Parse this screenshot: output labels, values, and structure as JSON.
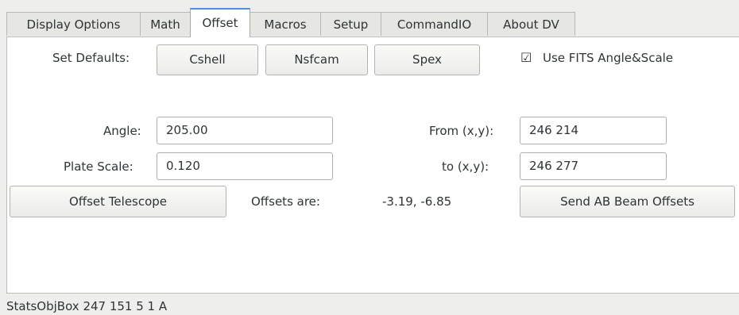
{
  "tabs": [
    {
      "label": "Display Options",
      "active": false
    },
    {
      "label": "Math",
      "active": false
    },
    {
      "label": "Offset",
      "active": true
    },
    {
      "label": "Macros",
      "active": false
    },
    {
      "label": "Setup",
      "active": false
    },
    {
      "label": "CommandIO",
      "active": false
    },
    {
      "label": "About DV",
      "active": false
    }
  ],
  "offset": {
    "set_defaults_label": "Set Defaults:",
    "defaults_buttons": [
      "Cshell",
      "Nsfcam",
      "Spex"
    ],
    "use_fits": {
      "label": "Use FITS Angle&Scale",
      "checked": true,
      "check_glyph": "☑"
    },
    "angle_label": "Angle:",
    "angle_value": "205.00",
    "plate_scale_label": "Plate Scale:",
    "plate_scale_value": "0.120",
    "from_label": "From (x,y):",
    "from_value": "246 214",
    "to_label": "to (x,y):",
    "to_value": "246 277",
    "offset_telescope_button": "Offset Telescope",
    "offsets_are_label": "Offsets are:",
    "offsets_value": "-3.19, -6.85",
    "send_ab_button": "Send AB Beam Offsets"
  },
  "status_bar": {
    "text": "StatsObjBox  247 151 5 1 A"
  },
  "colors": {
    "active_tab_accent": "#4a90d9",
    "panel_bg": "#ffffff",
    "window_bg": "#eeeeec"
  }
}
